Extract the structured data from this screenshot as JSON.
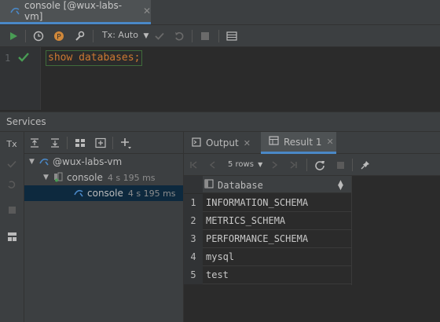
{
  "tab": {
    "label": "console [@wux-labs-vm]",
    "close": "✕"
  },
  "toolbar": {
    "tx_mode": "Tx: Auto"
  },
  "editor": {
    "line_number": "1",
    "code_keyword": "show databases",
    "code_semicolon": ";"
  },
  "services": {
    "title": "Services",
    "tx_label": "Tx",
    "tree": [
      {
        "label": "@wux-labs-vm",
        "time": ""
      },
      {
        "label": "console",
        "time": "4 s 195 ms"
      },
      {
        "label": "console",
        "time": "4 s 195 ms"
      }
    ]
  },
  "results": {
    "tabs": [
      {
        "label": "Output",
        "close": "✕"
      },
      {
        "label": "Result 1",
        "close": "✕"
      }
    ],
    "rows_selector": "5 rows",
    "column": "Database",
    "rows": [
      {
        "n": "1",
        "value": "INFORMATION_SCHEMA"
      },
      {
        "n": "2",
        "value": "METRICS_SCHEMA"
      },
      {
        "n": "3",
        "value": "PERFORMANCE_SCHEMA"
      },
      {
        "n": "4",
        "value": "mysql"
      },
      {
        "n": "5",
        "value": "test"
      }
    ]
  },
  "colors": {
    "accent": "#4a88c7",
    "run_green": "#499c54",
    "keyword": "#cc7832",
    "selection": "#0d293e"
  }
}
